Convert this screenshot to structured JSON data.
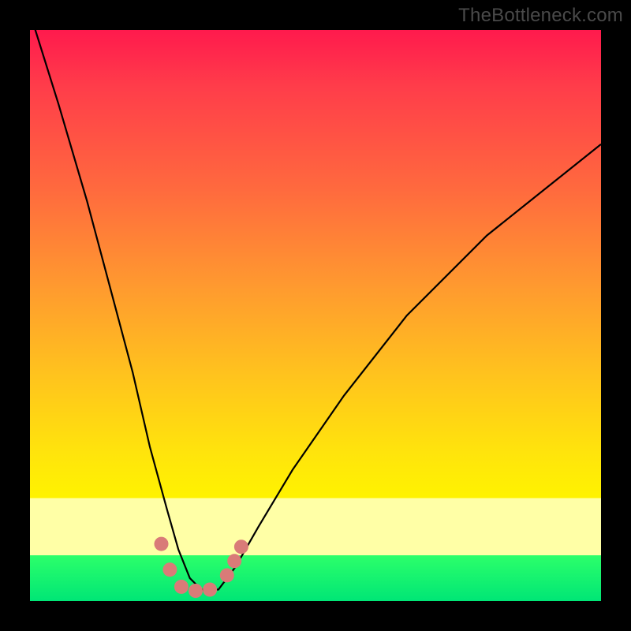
{
  "watermark": "TheBottleneck.com",
  "chart_data": {
    "type": "line",
    "title": "",
    "xlabel": "",
    "ylabel": "",
    "xlim": [
      0,
      100
    ],
    "ylim": [
      0,
      100
    ],
    "series": [
      {
        "name": "bottleneck-curve",
        "x": [
          0,
          5,
          10,
          14,
          18,
          21,
          24,
          26,
          28,
          30,
          33,
          36,
          40,
          46,
          55,
          66,
          80,
          100
        ],
        "values": [
          103,
          87,
          70,
          55,
          40,
          27,
          16,
          9,
          4,
          2,
          2,
          6,
          13,
          23,
          36,
          50,
          64,
          80
        ]
      }
    ],
    "markers": [
      {
        "x": 23.0,
        "y": 10.0
      },
      {
        "x": 24.5,
        "y": 5.5
      },
      {
        "x": 26.5,
        "y": 2.5
      },
      {
        "x": 29.0,
        "y": 1.8
      },
      {
        "x": 31.5,
        "y": 2.0
      },
      {
        "x": 34.5,
        "y": 4.5
      },
      {
        "x": 35.8,
        "y": 7.0
      },
      {
        "x": 37.0,
        "y": 9.5
      }
    ],
    "marker_color": "#d97b78",
    "curve_color": "#000000",
    "gradient_stops": [
      {
        "pos": 0.0,
        "color": "#ff1a4d"
      },
      {
        "pos": 0.28,
        "color": "#ff6a3e"
      },
      {
        "pos": 0.6,
        "color": "#ffc21e"
      },
      {
        "pos": 0.82,
        "color": "#fff300"
      },
      {
        "pos": 0.82,
        "color": "#ffffa6"
      },
      {
        "pos": 0.92,
        "color": "#ffffa6"
      },
      {
        "pos": 0.92,
        "color": "#2cff6a"
      },
      {
        "pos": 1.0,
        "color": "#00e676"
      }
    ]
  }
}
